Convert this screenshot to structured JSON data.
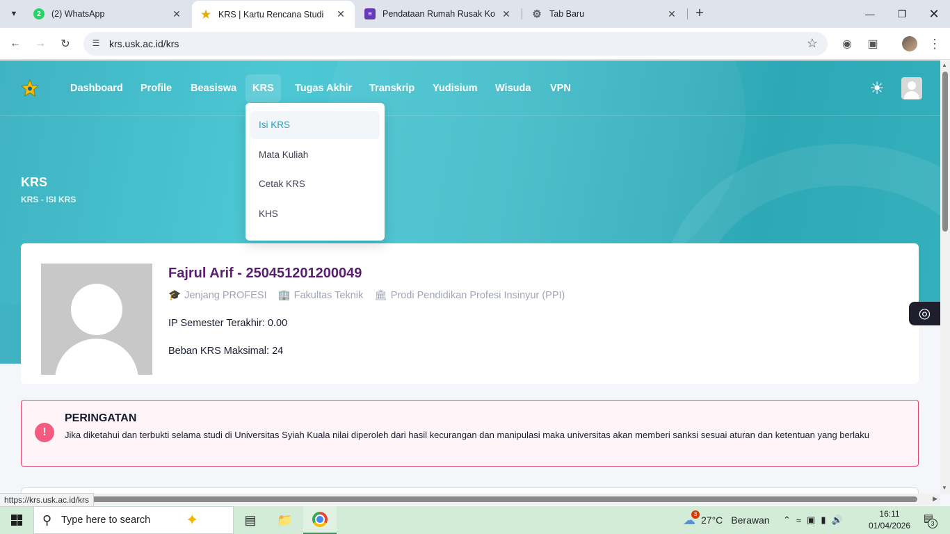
{
  "browser": {
    "tabs": [
      {
        "title": "(2) WhatsApp",
        "badge": "2",
        "favicon_color": "#25d366"
      },
      {
        "title": "KRS | Kartu Rencana Studi",
        "favicon_color": "#f2c200"
      },
      {
        "title": "Pendataan Rumah Rusak Kota L",
        "favicon_color": "#673ab7"
      },
      {
        "title": "Tab Baru",
        "favicon_color": "#5f6368"
      }
    ],
    "url": "krs.usk.ac.id/krs",
    "status_url": "https://krs.usk.ac.id/krs"
  },
  "nav": {
    "items": [
      "Dashboard",
      "Profile",
      "Beasiswa",
      "KRS",
      "Tugas Akhir",
      "Transkrip",
      "Yudisium",
      "Wisuda",
      "VPN"
    ],
    "active": "KRS"
  },
  "dropdown": {
    "items": [
      "Isi KRS",
      "Mata Kuliah",
      "Cetak KRS",
      "KHS"
    ],
    "active": "Isi KRS"
  },
  "header": {
    "title": "KRS",
    "breadcrumb": "KRS - ISI KRS"
  },
  "student": {
    "name": "Fajrul Arif - 250451201200049",
    "jenjang": "Jenjang PROFESI",
    "fakultas": "Fakultas Teknik",
    "prodi": "Prodi Pendidikan Profesi Insinyur (PPI)",
    "ip_semester": "IP Semester Terakhir: 0.00",
    "beban_krs": "Beban KRS Maksimal: 24"
  },
  "warning": {
    "title": "PERINGATAN",
    "text": "Jika diketahui dan terbukti selama studi di Universitas Syiah Kuala nilai diperoleh dari hasil kecurangan dan manipulasi maka universitas akan memberi sanksi sesuai aturan dan ketentuan yang berlaku"
  },
  "taskbar": {
    "search_placeholder": "Type here to search",
    "weather_badge": "3",
    "temperature": "27°C",
    "weather_text": "Berawan",
    "time": "16:11",
    "date": "01/04/2026",
    "notification_count": "3"
  },
  "colors": {
    "hero": "#43bcc9",
    "name": "#5a1e6e",
    "warning_border": "#e0406a",
    "taskbar": "#d2ecd7"
  }
}
